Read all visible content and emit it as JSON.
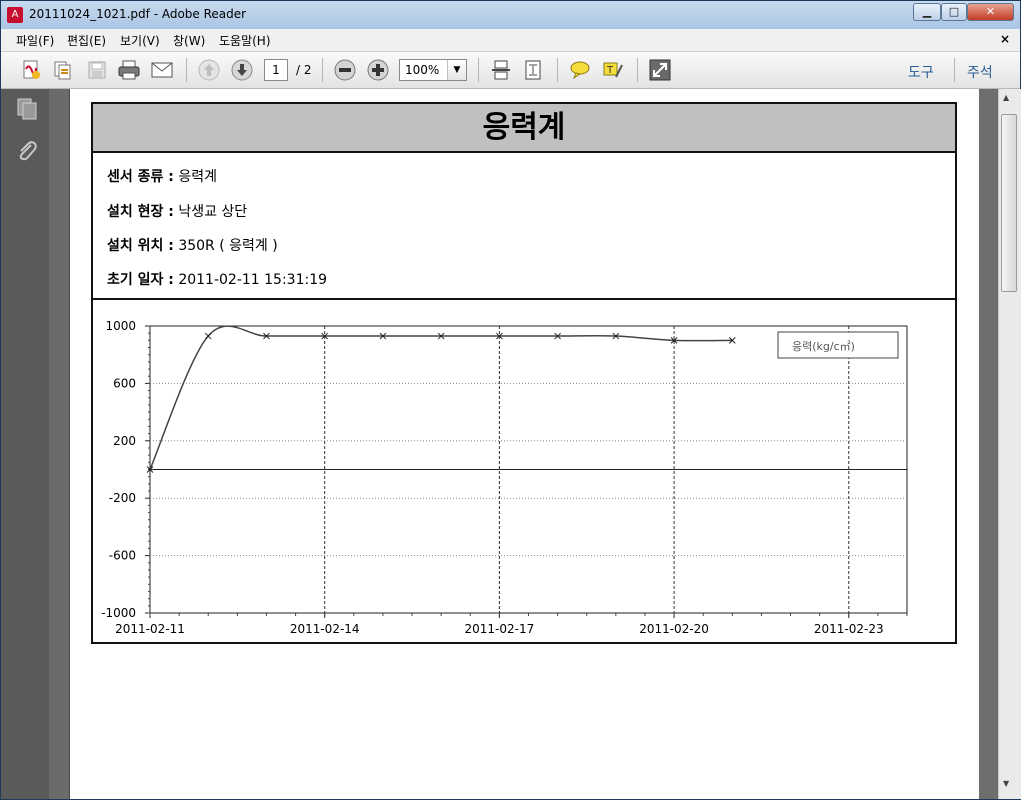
{
  "window": {
    "title": "20111024_1021.pdf - Adobe Reader",
    "minimize_icon": "minimize-icon",
    "maximize_icon": "maximize-icon",
    "close_icon": "close-icon"
  },
  "menubar": {
    "items": [
      "파일(F)",
      "편집(E)",
      "보기(V)",
      "창(W)",
      "도움말(H)"
    ],
    "close_label": "×"
  },
  "toolbar": {
    "page_current": "1",
    "page_total": "/ 2",
    "zoom": "100%",
    "tools_label": "도구",
    "comment_label": "주석"
  },
  "report": {
    "title": "응력계",
    "rows": [
      {
        "label": "센서 종류 :",
        "value": "응력계"
      },
      {
        "label": "설치 현장 :",
        "value": "낙생교 상단"
      },
      {
        "label": "설치 위치 :",
        "value": "350R ( 응력계 )"
      },
      {
        "label": "초기 일자 :",
        "value": "2011-02-11 15:31:19"
      }
    ]
  },
  "chart_data": {
    "type": "line",
    "x": [
      "2011-02-11",
      "2011-02-12",
      "2011-02-13",
      "2011-02-14",
      "2011-02-15",
      "2011-02-16",
      "2011-02-17",
      "2011-02-18",
      "2011-02-19",
      "2011-02-20",
      "2011-02-21"
    ],
    "x_ticks": [
      "2011-02-11",
      "2011-02-14",
      "2011-02-17",
      "2011-02-20",
      "2011-02-23"
    ],
    "xlim": [
      "2011-02-11",
      "2011-02-24"
    ],
    "series": [
      {
        "name": "응력(kg/c㎡)",
        "values": [
          0,
          930,
          930,
          930,
          930,
          930,
          930,
          930,
          930,
          900,
          900
        ],
        "color": "#444444"
      }
    ],
    "ylim": [
      -1000,
      1000
    ],
    "y_ticks": [
      1000,
      600,
      200,
      -200,
      -600,
      -1000
    ],
    "grid": true,
    "legend": "top-right"
  }
}
